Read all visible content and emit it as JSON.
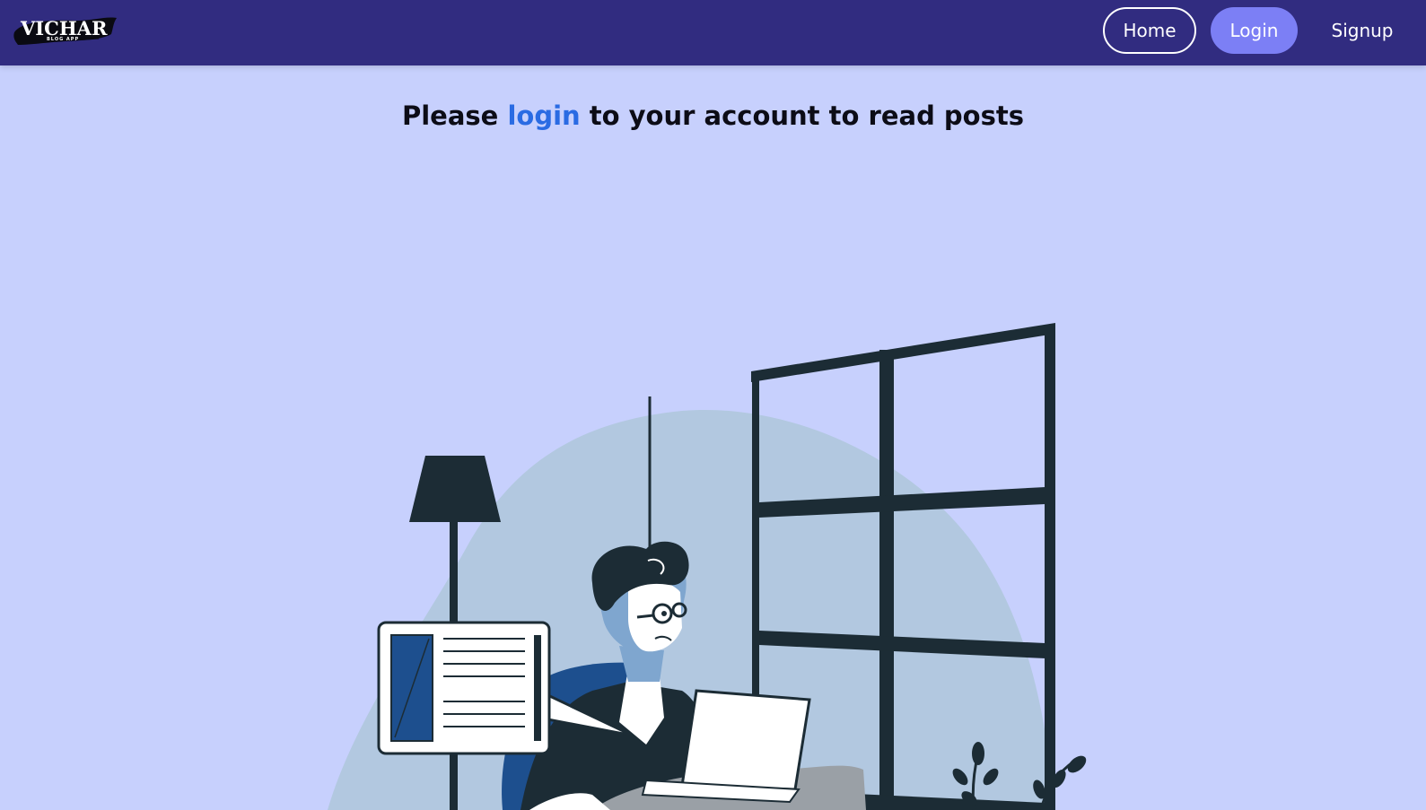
{
  "app": {
    "logo_title": "VICHAR",
    "logo_subtitle": "BLOG APP"
  },
  "nav": {
    "home_label": "Home",
    "login_label": "Login",
    "signup_label": "Signup"
  },
  "message": {
    "prefix": "Please ",
    "link_text": "login",
    "suffix": " to your account to read posts"
  },
  "colors": {
    "navbar": "#312c80",
    "background": "#c7d0fd",
    "accent_button": "#7c7ff5",
    "link": "#2a6be3"
  },
  "icons": {
    "illustration": "person-reading-on-laptop-illustration"
  }
}
